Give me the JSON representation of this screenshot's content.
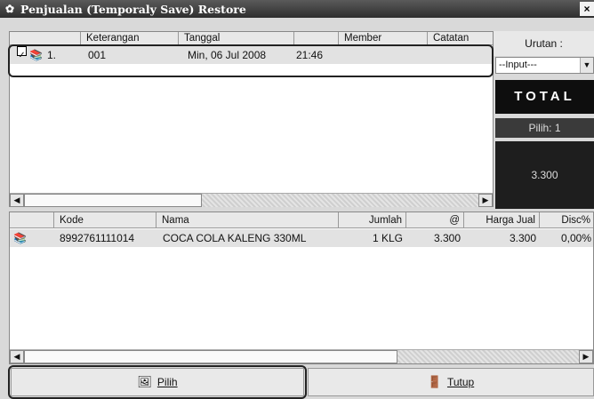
{
  "window": {
    "title": "Penjualan (Temporaly Save) Restore",
    "close_glyph": "×"
  },
  "master": {
    "columns": [
      "",
      "Keterangan",
      "Tanggal",
      "",
      "Member",
      "Catatan"
    ],
    "rows": [
      {
        "checked": true,
        "no": "1.",
        "keterangan": "001",
        "tanggal": "Min, 06 Jul 2008",
        "jam": "21:46",
        "member": "",
        "catatan": ""
      }
    ]
  },
  "sidebar": {
    "urutan_label": "Urutan :",
    "urutan_selected": "--Input---",
    "total_label": "TOTAL",
    "pilih_count": "Pilih: 1",
    "total_amount": "3.300"
  },
  "detail": {
    "columns": [
      "",
      "Kode",
      "Nama",
      "Jumlah",
      "@",
      "Harga Jual",
      "Disc%"
    ],
    "rows": [
      {
        "kode": "8992761111014",
        "nama": "COCA COLA KALENG 330ML",
        "jumlah": "1 KLG",
        "harga": "3.300",
        "harga_jual": "3.300",
        "disc": "0,00%"
      }
    ]
  },
  "buttons": {
    "pilih_label": "Pilih",
    "tutup_label": "Tutup"
  },
  "colors": {
    "titlebar": "#3c3c3c",
    "total_box": "#0e0e0e",
    "selected_row": "#e2e2e2"
  }
}
